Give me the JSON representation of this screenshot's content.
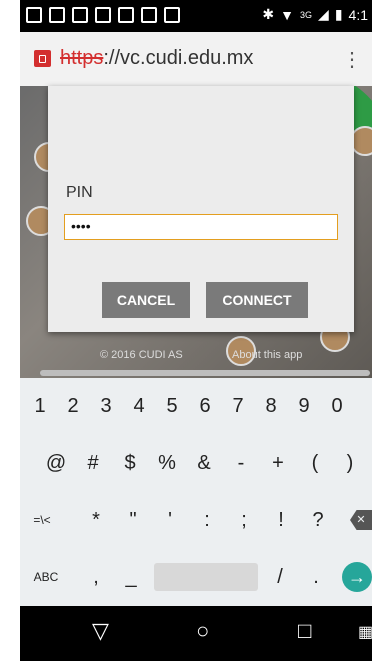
{
  "status_bar": {
    "network": "3G",
    "time": "4:1"
  },
  "browser": {
    "url_scheme": "https",
    "url_rest": "://vc.cudi.edu.mx",
    "menu_icon": "kebab-menu-icon"
  },
  "page": {
    "copyright": "© 2016 CUDI AS",
    "about": "About this app"
  },
  "dialog": {
    "pin_label": "PIN",
    "pin_value": "••••",
    "cancel_label": "CANCEL",
    "connect_label": "CONNECT",
    "input_border_color": "#e39e1f"
  },
  "keyboard": {
    "row1": [
      "1",
      "2",
      "3",
      "4",
      "5",
      "6",
      "7",
      "8",
      "9",
      "0"
    ],
    "row2": [
      "@",
      "#",
      "$",
      "%",
      "&",
      "-",
      "+",
      "(",
      ")"
    ],
    "row3": [
      "=\\<",
      "*",
      "\"",
      "'",
      ":",
      ";",
      "!",
      "?"
    ],
    "row4": {
      "abc": "ABC",
      "comma": ",",
      "underscore": "_",
      "slash": "/",
      "period": "."
    },
    "enter_color": "#26a69a"
  },
  "nav": {
    "back": "▽",
    "home": "○",
    "recents": "□"
  }
}
